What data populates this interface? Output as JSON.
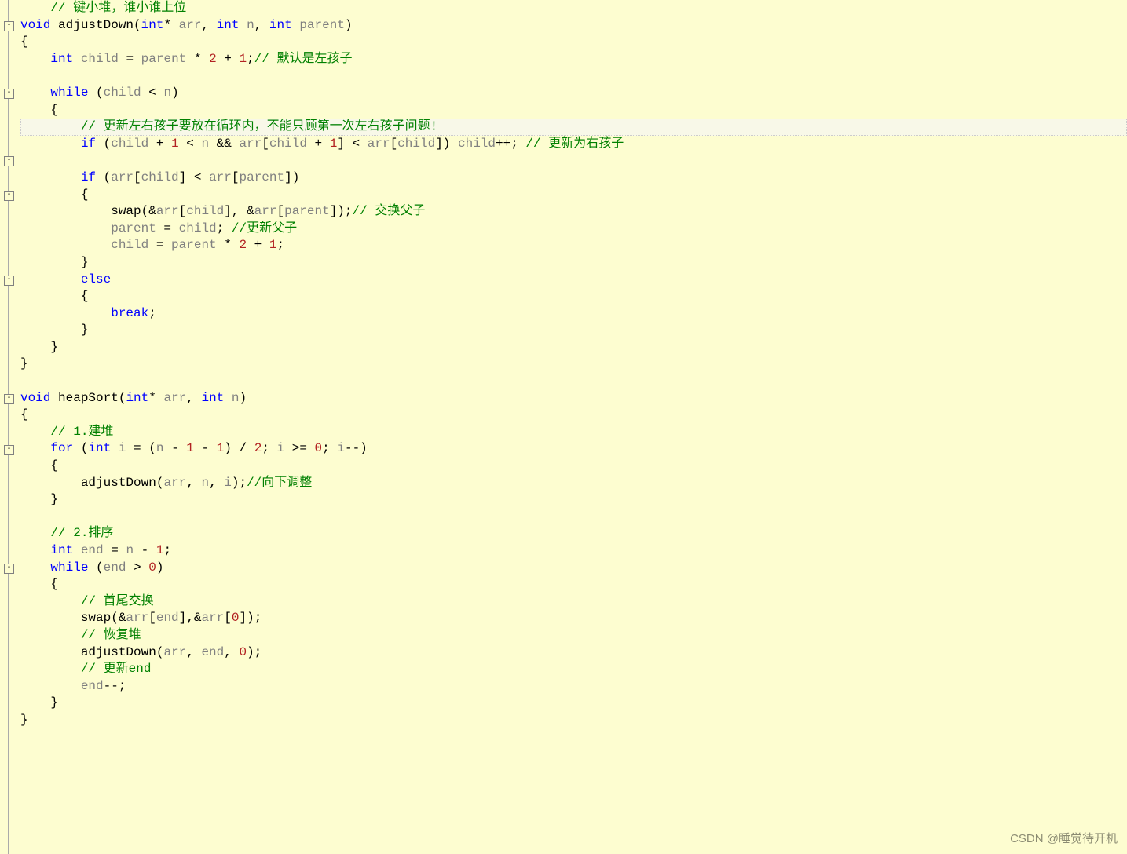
{
  "watermark": "CSDN @睡觉待开机",
  "fold_marks": [
    {
      "line_index": 1,
      "symbol": "-"
    },
    {
      "line_index": 5,
      "symbol": "-"
    },
    {
      "line_index": 9,
      "symbol": "-"
    },
    {
      "line_index": 11,
      "symbol": "-"
    },
    {
      "line_index": 16,
      "symbol": "-"
    },
    {
      "line_index": 23,
      "symbol": "-"
    },
    {
      "line_index": 26,
      "symbol": "-"
    },
    {
      "line_index": 33,
      "symbol": "-"
    }
  ],
  "highlight_line_index": 7,
  "lines": [
    [
      {
        "t": "    ",
        "c": ""
      },
      {
        "t": "// 键小堆，谁小谁上位",
        "c": "cmt"
      }
    ],
    [
      {
        "t": "void",
        "c": "type"
      },
      {
        "t": " ",
        "c": ""
      },
      {
        "t": "adjustDown",
        "c": "call"
      },
      {
        "t": "(",
        "c": "punct"
      },
      {
        "t": "int",
        "c": "type"
      },
      {
        "t": "* ",
        "c": "op"
      },
      {
        "t": "arr",
        "c": "ident"
      },
      {
        "t": ", ",
        "c": "punct"
      },
      {
        "t": "int",
        "c": "type"
      },
      {
        "t": " ",
        "c": ""
      },
      {
        "t": "n",
        "c": "ident"
      },
      {
        "t": ", ",
        "c": "punct"
      },
      {
        "t": "int",
        "c": "type"
      },
      {
        "t": " ",
        "c": ""
      },
      {
        "t": "parent",
        "c": "ident"
      },
      {
        "t": ")",
        "c": "punct"
      }
    ],
    [
      {
        "t": "{",
        "c": "punct"
      }
    ],
    [
      {
        "t": "    ",
        "c": ""
      },
      {
        "t": "int",
        "c": "type"
      },
      {
        "t": " ",
        "c": ""
      },
      {
        "t": "child",
        "c": "ident"
      },
      {
        "t": " = ",
        "c": "op"
      },
      {
        "t": "parent",
        "c": "ident"
      },
      {
        "t": " * ",
        "c": "op"
      },
      {
        "t": "2",
        "c": "num"
      },
      {
        "t": " + ",
        "c": "op"
      },
      {
        "t": "1",
        "c": "num"
      },
      {
        "t": ";",
        "c": "punct"
      },
      {
        "t": "// 默认是左孩子",
        "c": "cmt"
      }
    ],
    [
      {
        "t": " ",
        "c": ""
      }
    ],
    [
      {
        "t": "    ",
        "c": ""
      },
      {
        "t": "while",
        "c": "kw"
      },
      {
        "t": " (",
        "c": "punct"
      },
      {
        "t": "child",
        "c": "ident"
      },
      {
        "t": " < ",
        "c": "op"
      },
      {
        "t": "n",
        "c": "ident"
      },
      {
        "t": ")",
        "c": "punct"
      }
    ],
    [
      {
        "t": "    {",
        "c": "punct"
      }
    ],
    [
      {
        "t": "        ",
        "c": ""
      },
      {
        "t": "// 更新左右孩子要放在循环内，不能只顾第一次左右孩子问题!",
        "c": "cmt"
      }
    ],
    [
      {
        "t": "        ",
        "c": ""
      },
      {
        "t": "if",
        "c": "kw"
      },
      {
        "t": " (",
        "c": "punct"
      },
      {
        "t": "child",
        "c": "ident"
      },
      {
        "t": " + ",
        "c": "op"
      },
      {
        "t": "1",
        "c": "num"
      },
      {
        "t": " < ",
        "c": "op"
      },
      {
        "t": "n",
        "c": "ident"
      },
      {
        "t": " && ",
        "c": "op"
      },
      {
        "t": "arr",
        "c": "ident"
      },
      {
        "t": "[",
        "c": "punct"
      },
      {
        "t": "child",
        "c": "ident"
      },
      {
        "t": " + ",
        "c": "op"
      },
      {
        "t": "1",
        "c": "num"
      },
      {
        "t": "] < ",
        "c": "op"
      },
      {
        "t": "arr",
        "c": "ident"
      },
      {
        "t": "[",
        "c": "punct"
      },
      {
        "t": "child",
        "c": "ident"
      },
      {
        "t": "]) ",
        "c": "punct"
      },
      {
        "t": "child",
        "c": "ident"
      },
      {
        "t": "++; ",
        "c": "op"
      },
      {
        "t": "// 更新为右孩子",
        "c": "cmt"
      }
    ],
    [
      {
        "t": " ",
        "c": ""
      }
    ],
    [
      {
        "t": "        ",
        "c": ""
      },
      {
        "t": "if",
        "c": "kw"
      },
      {
        "t": " (",
        "c": "punct"
      },
      {
        "t": "arr",
        "c": "ident"
      },
      {
        "t": "[",
        "c": "punct"
      },
      {
        "t": "child",
        "c": "ident"
      },
      {
        "t": "] < ",
        "c": "op"
      },
      {
        "t": "arr",
        "c": "ident"
      },
      {
        "t": "[",
        "c": "punct"
      },
      {
        "t": "parent",
        "c": "ident"
      },
      {
        "t": "])",
        "c": "punct"
      }
    ],
    [
      {
        "t": "        {",
        "c": "punct"
      }
    ],
    [
      {
        "t": "            ",
        "c": ""
      },
      {
        "t": "swap",
        "c": "call"
      },
      {
        "t": "(&",
        "c": "op"
      },
      {
        "t": "arr",
        "c": "ident"
      },
      {
        "t": "[",
        "c": "punct"
      },
      {
        "t": "child",
        "c": "ident"
      },
      {
        "t": "], &",
        "c": "op"
      },
      {
        "t": "arr",
        "c": "ident"
      },
      {
        "t": "[",
        "c": "punct"
      },
      {
        "t": "parent",
        "c": "ident"
      },
      {
        "t": "]);",
        "c": "punct"
      },
      {
        "t": "// 交换父子",
        "c": "cmt"
      }
    ],
    [
      {
        "t": "            ",
        "c": ""
      },
      {
        "t": "parent",
        "c": "ident"
      },
      {
        "t": " = ",
        "c": "op"
      },
      {
        "t": "child",
        "c": "ident"
      },
      {
        "t": "; ",
        "c": "punct"
      },
      {
        "t": "//更新父子",
        "c": "cmt"
      }
    ],
    [
      {
        "t": "            ",
        "c": ""
      },
      {
        "t": "child",
        "c": "ident"
      },
      {
        "t": " = ",
        "c": "op"
      },
      {
        "t": "parent",
        "c": "ident"
      },
      {
        "t": " * ",
        "c": "op"
      },
      {
        "t": "2",
        "c": "num"
      },
      {
        "t": " + ",
        "c": "op"
      },
      {
        "t": "1",
        "c": "num"
      },
      {
        "t": ";",
        "c": "punct"
      }
    ],
    [
      {
        "t": "        }",
        "c": "punct"
      }
    ],
    [
      {
        "t": "        ",
        "c": ""
      },
      {
        "t": "else",
        "c": "kw"
      }
    ],
    [
      {
        "t": "        {",
        "c": "punct"
      }
    ],
    [
      {
        "t": "            ",
        "c": ""
      },
      {
        "t": "break",
        "c": "kw"
      },
      {
        "t": ";",
        "c": "punct"
      }
    ],
    [
      {
        "t": "        }",
        "c": "punct"
      }
    ],
    [
      {
        "t": "    }",
        "c": "punct"
      }
    ],
    [
      {
        "t": "}",
        "c": "punct"
      }
    ],
    [
      {
        "t": " ",
        "c": ""
      }
    ],
    [
      {
        "t": "void",
        "c": "type"
      },
      {
        "t": " ",
        "c": ""
      },
      {
        "t": "heapSort",
        "c": "call"
      },
      {
        "t": "(",
        "c": "punct"
      },
      {
        "t": "int",
        "c": "type"
      },
      {
        "t": "* ",
        "c": "op"
      },
      {
        "t": "arr",
        "c": "ident"
      },
      {
        "t": ", ",
        "c": "punct"
      },
      {
        "t": "int",
        "c": "type"
      },
      {
        "t": " ",
        "c": ""
      },
      {
        "t": "n",
        "c": "ident"
      },
      {
        "t": ")",
        "c": "punct"
      }
    ],
    [
      {
        "t": "{",
        "c": "punct"
      }
    ],
    [
      {
        "t": "    ",
        "c": ""
      },
      {
        "t": "// 1.建堆",
        "c": "cmt"
      }
    ],
    [
      {
        "t": "    ",
        "c": ""
      },
      {
        "t": "for",
        "c": "kw"
      },
      {
        "t": " (",
        "c": "punct"
      },
      {
        "t": "int",
        "c": "type"
      },
      {
        "t": " ",
        "c": ""
      },
      {
        "t": "i",
        "c": "ident"
      },
      {
        "t": " = (",
        "c": "op"
      },
      {
        "t": "n",
        "c": "ident"
      },
      {
        "t": " - ",
        "c": "op"
      },
      {
        "t": "1",
        "c": "num"
      },
      {
        "t": " - ",
        "c": "op"
      },
      {
        "t": "1",
        "c": "num"
      },
      {
        "t": ") / ",
        "c": "op"
      },
      {
        "t": "2",
        "c": "num"
      },
      {
        "t": "; ",
        "c": "punct"
      },
      {
        "t": "i",
        "c": "ident"
      },
      {
        "t": " >= ",
        "c": "op"
      },
      {
        "t": "0",
        "c": "num"
      },
      {
        "t": "; ",
        "c": "punct"
      },
      {
        "t": "i",
        "c": "ident"
      },
      {
        "t": "--)",
        "c": "op"
      }
    ],
    [
      {
        "t": "    {",
        "c": "punct"
      }
    ],
    [
      {
        "t": "        ",
        "c": ""
      },
      {
        "t": "adjustDown",
        "c": "call"
      },
      {
        "t": "(",
        "c": "punct"
      },
      {
        "t": "arr",
        "c": "ident"
      },
      {
        "t": ", ",
        "c": "punct"
      },
      {
        "t": "n",
        "c": "ident"
      },
      {
        "t": ", ",
        "c": "punct"
      },
      {
        "t": "i",
        "c": "ident"
      },
      {
        "t": ");",
        "c": "punct"
      },
      {
        "t": "//向下调整",
        "c": "cmt"
      }
    ],
    [
      {
        "t": "    }",
        "c": "punct"
      }
    ],
    [
      {
        "t": " ",
        "c": ""
      }
    ],
    [
      {
        "t": "    ",
        "c": ""
      },
      {
        "t": "// 2.排序",
        "c": "cmt"
      }
    ],
    [
      {
        "t": "    ",
        "c": ""
      },
      {
        "t": "int",
        "c": "type"
      },
      {
        "t": " ",
        "c": ""
      },
      {
        "t": "end",
        "c": "ident"
      },
      {
        "t": " = ",
        "c": "op"
      },
      {
        "t": "n",
        "c": "ident"
      },
      {
        "t": " - ",
        "c": "op"
      },
      {
        "t": "1",
        "c": "num"
      },
      {
        "t": ";",
        "c": "punct"
      }
    ],
    [
      {
        "t": "    ",
        "c": ""
      },
      {
        "t": "while",
        "c": "kw"
      },
      {
        "t": " (",
        "c": "punct"
      },
      {
        "t": "end",
        "c": "ident"
      },
      {
        "t": " > ",
        "c": "op"
      },
      {
        "t": "0",
        "c": "num"
      },
      {
        "t": ")",
        "c": "punct"
      }
    ],
    [
      {
        "t": "    {",
        "c": "punct"
      }
    ],
    [
      {
        "t": "        ",
        "c": ""
      },
      {
        "t": "// 首尾交换",
        "c": "cmt"
      }
    ],
    [
      {
        "t": "        ",
        "c": ""
      },
      {
        "t": "swap",
        "c": "call"
      },
      {
        "t": "(&",
        "c": "op"
      },
      {
        "t": "arr",
        "c": "ident"
      },
      {
        "t": "[",
        "c": "punct"
      },
      {
        "t": "end",
        "c": "ident"
      },
      {
        "t": "],&",
        "c": "op"
      },
      {
        "t": "arr",
        "c": "ident"
      },
      {
        "t": "[",
        "c": "punct"
      },
      {
        "t": "0",
        "c": "num"
      },
      {
        "t": "]);",
        "c": "punct"
      }
    ],
    [
      {
        "t": "        ",
        "c": ""
      },
      {
        "t": "// 恢复堆",
        "c": "cmt"
      }
    ],
    [
      {
        "t": "        ",
        "c": ""
      },
      {
        "t": "adjustDown",
        "c": "call"
      },
      {
        "t": "(",
        "c": "punct"
      },
      {
        "t": "arr",
        "c": "ident"
      },
      {
        "t": ", ",
        "c": "punct"
      },
      {
        "t": "end",
        "c": "ident"
      },
      {
        "t": ", ",
        "c": "punct"
      },
      {
        "t": "0",
        "c": "num"
      },
      {
        "t": ");",
        "c": "punct"
      }
    ],
    [
      {
        "t": "        ",
        "c": ""
      },
      {
        "t": "// 更新end",
        "c": "cmt"
      }
    ],
    [
      {
        "t": "        ",
        "c": ""
      },
      {
        "t": "end",
        "c": "ident"
      },
      {
        "t": "--;",
        "c": "op"
      }
    ],
    [
      {
        "t": "    }",
        "c": "punct"
      }
    ],
    [
      {
        "t": "}",
        "c": "punct"
      }
    ]
  ]
}
